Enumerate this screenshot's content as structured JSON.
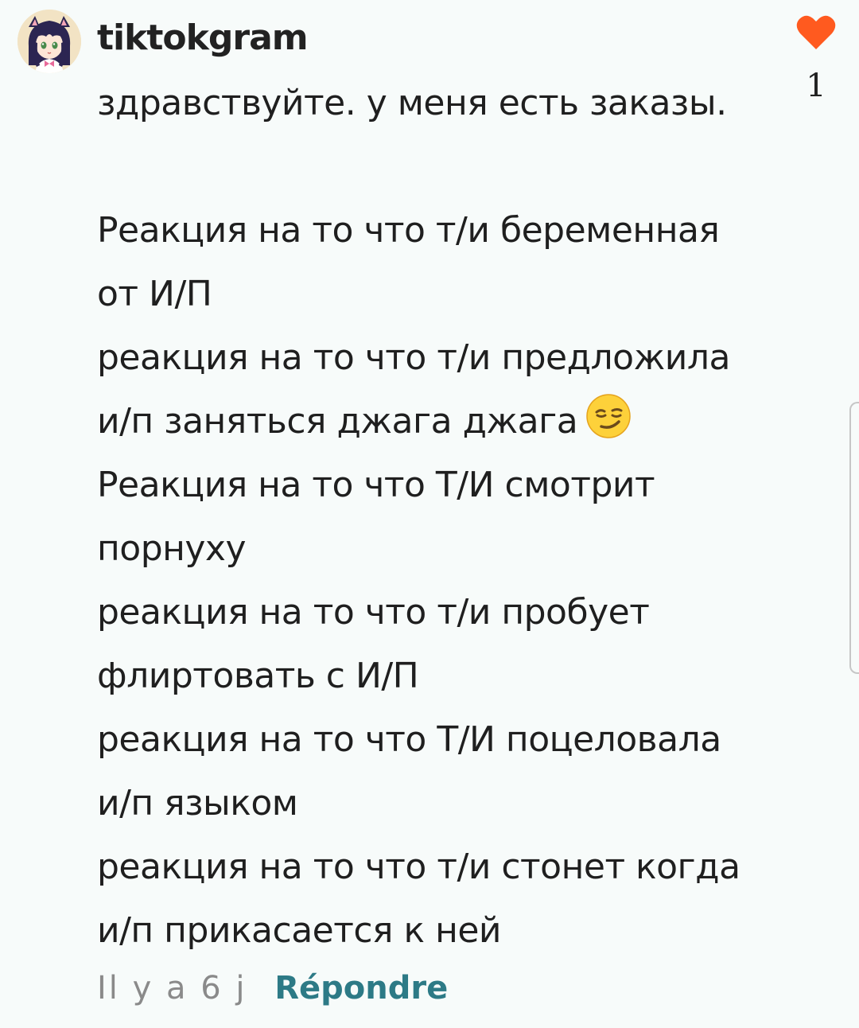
{
  "comment": {
    "username": "tiktokgram",
    "lines": [
      "здравствуйте. у меня есть заказы.",
      "",
      "Реакция на то что т/и беременная",
      "от И/П",
      "реакция на то что т/и предложила",
      "и/п заняться джага джага",
      "Реакция на то что Т/И смотрит",
      "порнуху",
      "реакция на то что т/и пробует",
      "флиртовать с И/П",
      "реакция на то что Т/И поцеловала",
      "и/п языком",
      "реакция на то что т/и стонет когда",
      "и/п прикасается к ней"
    ],
    "emoji": "smirking-face",
    "like_count": "1",
    "timestamp": "Il y a 6 j",
    "reply_label": "Répondre"
  },
  "colors": {
    "background": "#f7fbfa",
    "heart": "#ff5a1f",
    "reply": "#2d7a86",
    "timestamp": "#8a8a8a"
  },
  "icons": {
    "like": "heart-icon",
    "avatar": "anime-girl-avatar"
  }
}
